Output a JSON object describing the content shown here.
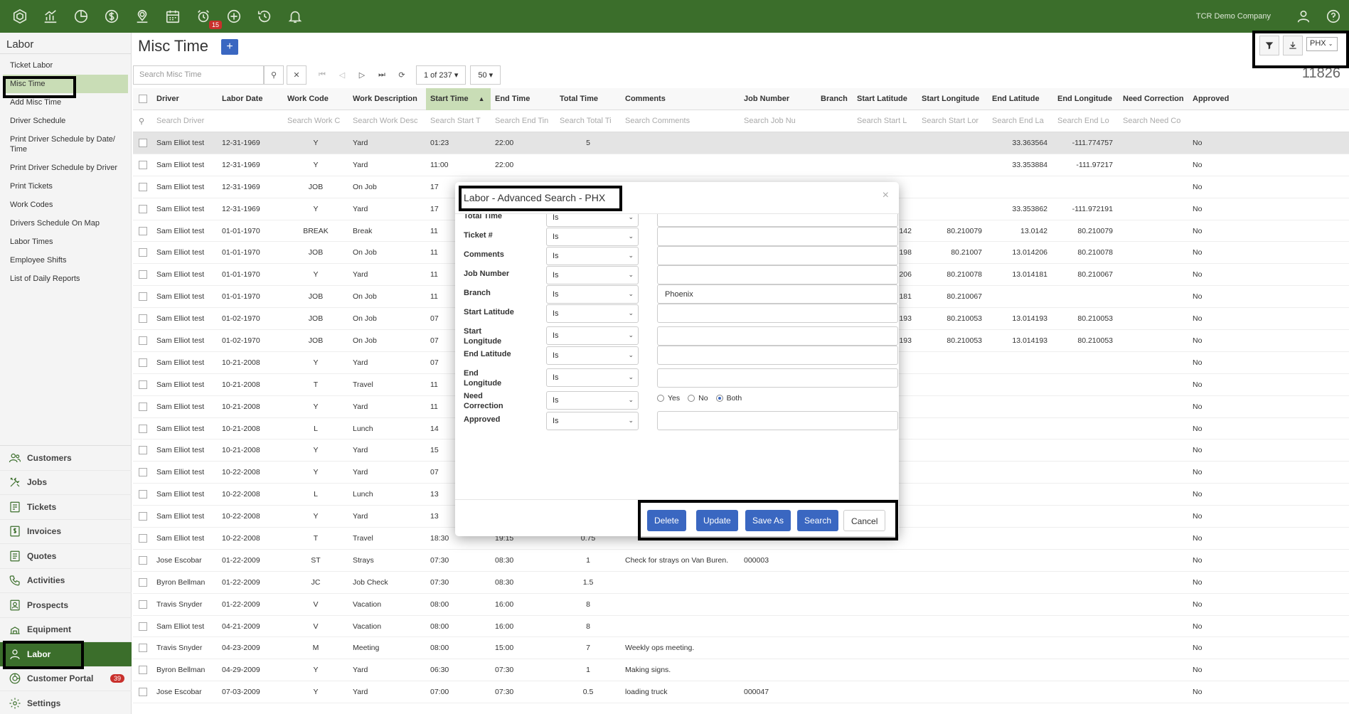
{
  "topbar": {
    "icons": [
      "hexagon-icon",
      "chart-icon",
      "pie-icon",
      "dollar-icon",
      "location-icon",
      "calendar-icon",
      "alarm-icon",
      "plus-circle-icon",
      "history-icon",
      "bell-icon"
    ],
    "alarm_badge": "15",
    "company": "TCR Demo Company"
  },
  "sidebar": {
    "title": "Labor",
    "items": [
      {
        "label": "Ticket Labor"
      },
      {
        "label": "Misc Time"
      },
      {
        "label": "Add Misc Time"
      },
      {
        "label": "Driver Schedule"
      },
      {
        "label": "Print Driver Schedule by Date/ Time"
      },
      {
        "label": "Print Driver Schedule by Driver"
      },
      {
        "label": "Print Tickets"
      },
      {
        "label": "Work Codes"
      },
      {
        "label": "Drivers Schedule On Map"
      },
      {
        "label": "Labor Times"
      },
      {
        "label": "Employee Shifts"
      },
      {
        "label": "List of Daily Reports"
      }
    ],
    "modules": [
      {
        "label": "Customers",
        "icon": "users-icon"
      },
      {
        "label": "Jobs",
        "icon": "tools-icon"
      },
      {
        "label": "Tickets",
        "icon": "ticket-icon"
      },
      {
        "label": "Invoices",
        "icon": "invoice-icon"
      },
      {
        "label": "Quotes",
        "icon": "quote-icon"
      },
      {
        "label": "Activities",
        "icon": "phone-icon"
      },
      {
        "label": "Prospects",
        "icon": "prospects-icon"
      },
      {
        "label": "Equipment",
        "icon": "equipment-icon"
      },
      {
        "label": "Labor",
        "icon": "person-icon"
      },
      {
        "label": "Customer Portal",
        "icon": "portal-icon",
        "badge": "39"
      },
      {
        "label": "Settings",
        "icon": "gear-icon"
      }
    ]
  },
  "header": {
    "title": "Misc Time",
    "add": "+",
    "branch": "PHX",
    "count": "11826"
  },
  "toolbar": {
    "search_placeholder": "Search Misc Time",
    "pager": "1 of 237 ▾",
    "page_size": "50 ▾"
  },
  "table": {
    "columns": [
      "Driver",
      "Labor Date",
      "Work Code",
      "Work Description",
      "Start Time",
      "End Time",
      "Total Time",
      "Comments",
      "Job Number",
      "Branch",
      "Start Latitude",
      "Start Longitude",
      "End Latitude",
      "End Longitude",
      "Need Correction",
      "Approved"
    ],
    "search": [
      "Search Driver",
      "",
      "Search Work C",
      "Search Work Desc",
      "Search Start T",
      "Search End Tin",
      "Search Total Ti",
      "Search Comments",
      "Search Job Nu",
      "",
      "Search Start L",
      "Search Start Lor",
      "Search End La",
      "Search End Lo",
      "Search Need Co",
      ""
    ],
    "rows": [
      {
        "driver": "Sam Elliot test",
        "date": "12-31-1969",
        "code": "Y",
        "desc": "Yard",
        "start": "01:23",
        "end": "22:00",
        "total": "5",
        "comments": "",
        "job": "",
        "slat": "",
        "slon": "",
        "elat": "33.363564",
        "elon": "-111.774757",
        "appr": "No"
      },
      {
        "driver": "Sam Elliot test",
        "date": "12-31-1969",
        "code": "Y",
        "desc": "Yard",
        "start": "11:00",
        "end": "22:00",
        "total": "",
        "comments": "",
        "job": "",
        "slat": "",
        "slon": "",
        "elat": "33.353884",
        "elon": "-111.97217",
        "appr": "No"
      },
      {
        "driver": "Sam Elliot test",
        "date": "12-31-1969",
        "code": "JOB",
        "desc": "On Job",
        "start": "17",
        "end": "",
        "total": "",
        "comments": "",
        "job": "",
        "slat": "",
        "slon": "",
        "elat": "",
        "elon": "",
        "appr": "No"
      },
      {
        "driver": "Sam Elliot test",
        "date": "12-31-1969",
        "code": "Y",
        "desc": "Yard",
        "start": "17",
        "end": "",
        "total": "",
        "comments": "",
        "job": "",
        "slat": "",
        "slon": "",
        "elat": "33.353862",
        "elon": "-111.972191",
        "appr": "No"
      },
      {
        "driver": "Sam Elliot test",
        "date": "01-01-1970",
        "code": "BREAK",
        "desc": "Break",
        "start": "11",
        "end": "",
        "total": "",
        "comments": "",
        "job": "",
        "slat": "142",
        "slon": "80.210079",
        "elat": "13.0142",
        "elon": "80.210079",
        "appr": "No"
      },
      {
        "driver": "Sam Elliot test",
        "date": "01-01-1970",
        "code": "JOB",
        "desc": "On Job",
        "start": "11",
        "end": "",
        "total": "",
        "comments": "",
        "job": "",
        "slat": "198",
        "slon": "80.21007",
        "elat": "13.014206",
        "elon": "80.210078",
        "appr": "No"
      },
      {
        "driver": "Sam Elliot test",
        "date": "01-01-1970",
        "code": "Y",
        "desc": "Yard",
        "start": "11",
        "end": "",
        "total": "",
        "comments": "",
        "job": "",
        "slat": "206",
        "slon": "80.210078",
        "elat": "13.014181",
        "elon": "80.210067",
        "appr": "No"
      },
      {
        "driver": "Sam Elliot test",
        "date": "01-01-1970",
        "code": "JOB",
        "desc": "On Job",
        "start": "11",
        "end": "",
        "total": "",
        "comments": "",
        "job": "",
        "slat": "181",
        "slon": "80.210067",
        "elat": "",
        "elon": "",
        "appr": "No"
      },
      {
        "driver": "Sam Elliot test",
        "date": "01-02-1970",
        "code": "JOB",
        "desc": "On Job",
        "start": "07",
        "end": "",
        "total": "",
        "comments": "",
        "job": "",
        "slat": "193",
        "slon": "80.210053",
        "elat": "13.014193",
        "elon": "80.210053",
        "appr": "No"
      },
      {
        "driver": "Sam Elliot test",
        "date": "01-02-1970",
        "code": "JOB",
        "desc": "On Job",
        "start": "07",
        "end": "",
        "total": "",
        "comments": "",
        "job": "",
        "slat": "193",
        "slon": "80.210053",
        "elat": "13.014193",
        "elon": "80.210053",
        "appr": "No"
      },
      {
        "driver": "Sam Elliot test",
        "date": "10-21-2008",
        "code": "Y",
        "desc": "Yard",
        "start": "07",
        "end": "",
        "total": "",
        "comments": "",
        "job": "",
        "slat": "",
        "slon": "",
        "elat": "",
        "elon": "",
        "appr": "No"
      },
      {
        "driver": "Sam Elliot test",
        "date": "10-21-2008",
        "code": "T",
        "desc": "Travel",
        "start": "11",
        "end": "",
        "total": "",
        "comments": "",
        "job": "",
        "slat": "",
        "slon": "",
        "elat": "",
        "elon": "",
        "appr": "No"
      },
      {
        "driver": "Sam Elliot test",
        "date": "10-21-2008",
        "code": "Y",
        "desc": "Yard",
        "start": "11",
        "end": "",
        "total": "",
        "comments": "",
        "job": "",
        "slat": "",
        "slon": "",
        "elat": "",
        "elon": "",
        "appr": "No"
      },
      {
        "driver": "Sam Elliot test",
        "date": "10-21-2008",
        "code": "L",
        "desc": "Lunch",
        "start": "14",
        "end": "",
        "total": "",
        "comments": "",
        "job": "",
        "slat": "",
        "slon": "",
        "elat": "",
        "elon": "",
        "appr": "No"
      },
      {
        "driver": "Sam Elliot test",
        "date": "10-21-2008",
        "code": "Y",
        "desc": "Yard",
        "start": "15",
        "end": "",
        "total": "",
        "comments": "",
        "job": "",
        "slat": "",
        "slon": "",
        "elat": "",
        "elon": "",
        "appr": "No"
      },
      {
        "driver": "Sam Elliot test",
        "date": "10-22-2008",
        "code": "Y",
        "desc": "Yard",
        "start": "07",
        "end": "",
        "total": "",
        "comments": "",
        "job": "",
        "slat": "",
        "slon": "",
        "elat": "",
        "elon": "",
        "appr": "No"
      },
      {
        "driver": "Sam Elliot test",
        "date": "10-22-2008",
        "code": "L",
        "desc": "Lunch",
        "start": "13",
        "end": "",
        "total": "",
        "comments": "",
        "job": "",
        "slat": "",
        "slon": "",
        "elat": "",
        "elon": "",
        "appr": "No"
      },
      {
        "driver": "Sam Elliot test",
        "date": "10-22-2008",
        "code": "Y",
        "desc": "Yard",
        "start": "13",
        "end": "",
        "total": "",
        "comments": "",
        "job": "",
        "slat": "",
        "slon": "",
        "elat": "",
        "elon": "",
        "appr": "No"
      },
      {
        "driver": "Sam Elliot test",
        "date": "10-22-2008",
        "code": "T",
        "desc": "Travel",
        "start": "18:30",
        "end": "19:15",
        "total": "0.75",
        "comments": "",
        "job": "",
        "slat": "",
        "slon": "",
        "elat": "",
        "elon": "",
        "appr": "No"
      },
      {
        "driver": "Jose Escobar",
        "date": "01-22-2009",
        "code": "ST",
        "desc": "Strays",
        "start": "07:30",
        "end": "08:30",
        "total": "1",
        "comments": "Check for strays on Van Buren.",
        "job": "000003",
        "slat": "",
        "slon": "",
        "elat": "",
        "elon": "",
        "appr": "No"
      },
      {
        "driver": "Byron Bellman",
        "date": "01-22-2009",
        "code": "JC",
        "desc": "Job Check",
        "start": "07:30",
        "end": "08:30",
        "total": "1.5",
        "comments": "",
        "job": "",
        "slat": "",
        "slon": "",
        "elat": "",
        "elon": "",
        "appr": "No"
      },
      {
        "driver": "Travis Snyder",
        "date": "01-22-2009",
        "code": "V",
        "desc": "Vacation",
        "start": "08:00",
        "end": "16:00",
        "total": "8",
        "comments": "",
        "job": "",
        "slat": "",
        "slon": "",
        "elat": "",
        "elon": "",
        "appr": "No"
      },
      {
        "driver": "Sam Elliot test",
        "date": "04-21-2009",
        "code": "V",
        "desc": "Vacation",
        "start": "08:00",
        "end": "16:00",
        "total": "8",
        "comments": "",
        "job": "",
        "slat": "",
        "slon": "",
        "elat": "",
        "elon": "",
        "appr": "No"
      },
      {
        "driver": "Travis Snyder",
        "date": "04-23-2009",
        "code": "M",
        "desc": "Meeting",
        "start": "08:00",
        "end": "15:00",
        "total": "7",
        "comments": "Weekly ops meeting.",
        "job": "",
        "slat": "",
        "slon": "",
        "elat": "",
        "elon": "",
        "appr": "No"
      },
      {
        "driver": "Byron Bellman",
        "date": "04-29-2009",
        "code": "Y",
        "desc": "Yard",
        "start": "06:30",
        "end": "07:30",
        "total": "1",
        "comments": "Making signs.",
        "job": "",
        "slat": "",
        "slon": "",
        "elat": "",
        "elon": "",
        "appr": "No"
      },
      {
        "driver": "Jose Escobar",
        "date": "07-03-2009",
        "code": "Y",
        "desc": "Yard",
        "start": "07:00",
        "end": "07:30",
        "total": "0.5",
        "comments": "loading truck",
        "job": "000047",
        "slat": "",
        "slon": "",
        "elat": "",
        "elon": "",
        "appr": "No"
      }
    ]
  },
  "modal": {
    "title": "Labor - Advanced Search - PHX",
    "close": "×",
    "fields": [
      {
        "label": "Total Time",
        "op": "Is",
        "value": ""
      },
      {
        "label": "Ticket #",
        "op": "Is",
        "value": ""
      },
      {
        "label": "Comments",
        "op": "Is",
        "value": ""
      },
      {
        "label": "Job Number",
        "op": "Is",
        "value": ""
      },
      {
        "label": "Branch",
        "op": "Is",
        "value": "Phoenix"
      },
      {
        "label": "Start Latitude",
        "op": "Is",
        "value": ""
      },
      {
        "label": "Start Longitude",
        "op": "Is",
        "value": ""
      },
      {
        "label": "End Latitude",
        "op": "Is",
        "value": ""
      },
      {
        "label": "End Longitude",
        "op": "Is",
        "value": ""
      },
      {
        "label": "Need Correction",
        "op": "Is",
        "radio": true
      },
      {
        "label": "Approved",
        "op": "Is",
        "value": ""
      }
    ],
    "radio_options": [
      "Yes",
      "No",
      "Both"
    ],
    "radio_selected": "Both",
    "buttons": {
      "delete": "Delete",
      "update": "Update",
      "save_as": "Save As",
      "search": "Search",
      "cancel": "Cancel"
    }
  },
  "colors": {
    "brand_green": "#3b6e2b",
    "primary_blue": "#3a67c1",
    "highlight": "#000000"
  }
}
